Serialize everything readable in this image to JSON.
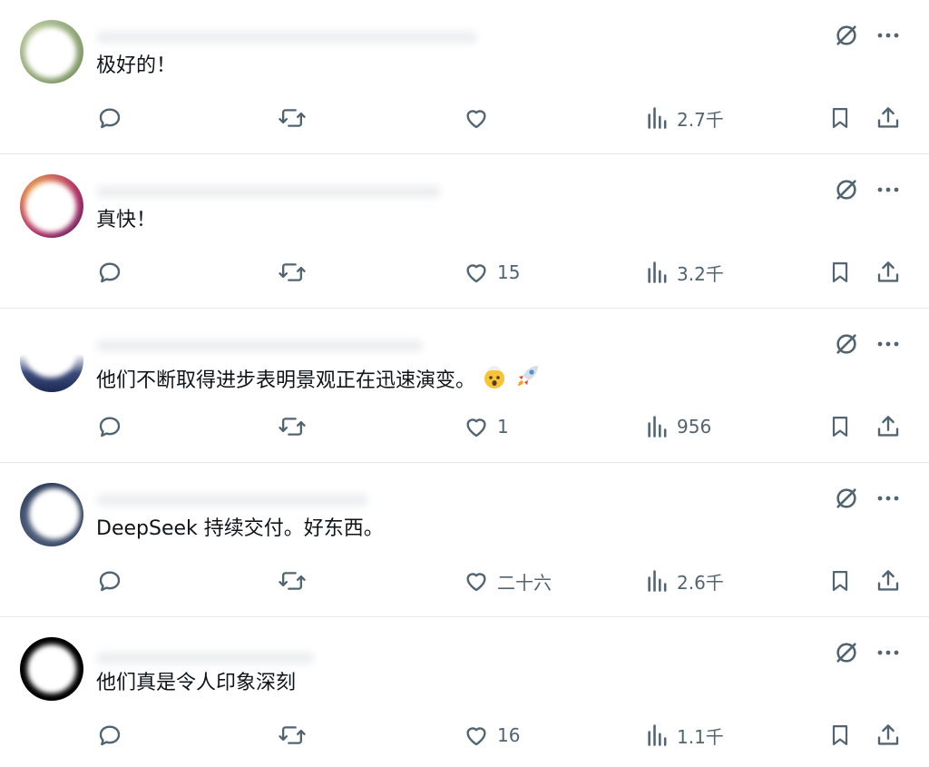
{
  "colors": {
    "icon": "#536471",
    "text": "#0f1419",
    "divider": "#e6e9ec",
    "background": "#ffffff"
  },
  "replies": [
    {
      "text": "极好的！",
      "avatar_colors": [
        "#6f8a57",
        "#c3d0a9"
      ],
      "reply_count": "",
      "repost_count": "",
      "like_count": "",
      "view_count": "2.7千",
      "emoji": []
    },
    {
      "text": "真快！",
      "avatar_colors": [
        "#b2346a",
        "#f0b04a"
      ],
      "reply_count": "",
      "repost_count": "",
      "like_count": "15",
      "view_count": "3.2千",
      "emoji": []
    },
    {
      "text": "他们不断取得进步表明景观正在迅速演变。",
      "avatar_colors": [
        "#1d2a55",
        "#3a4a7a"
      ],
      "reply_count": "",
      "repost_count": "",
      "like_count": "1",
      "view_count": "956",
      "emoji": [
        "exploding-head-emoji",
        "rocket-emoji"
      ]
    },
    {
      "text": "DeepSeek 持续交付。好东西。",
      "avatar_colors": [
        "#2a3956",
        "#6d7c99"
      ],
      "reply_count": "",
      "repost_count": "",
      "like_count": "二十六",
      "view_count": "2.6千",
      "emoji": []
    },
    {
      "text": "他们真是令人印象深刻",
      "avatar_colors": [
        "#000000",
        "#1a1a1a"
      ],
      "reply_count": "",
      "repost_count": "",
      "like_count": "16",
      "view_count": "1.1千",
      "emoji": []
    }
  ],
  "icons": {
    "reply": "speech-bubble-icon",
    "repost": "repost-arrows-icon",
    "like": "heart-icon",
    "views": "bar-chart-icon",
    "bookmark": "bookmark-icon",
    "share": "share-upload-icon",
    "grok": "grok-slash-icon",
    "more": "more-dots-icon"
  }
}
